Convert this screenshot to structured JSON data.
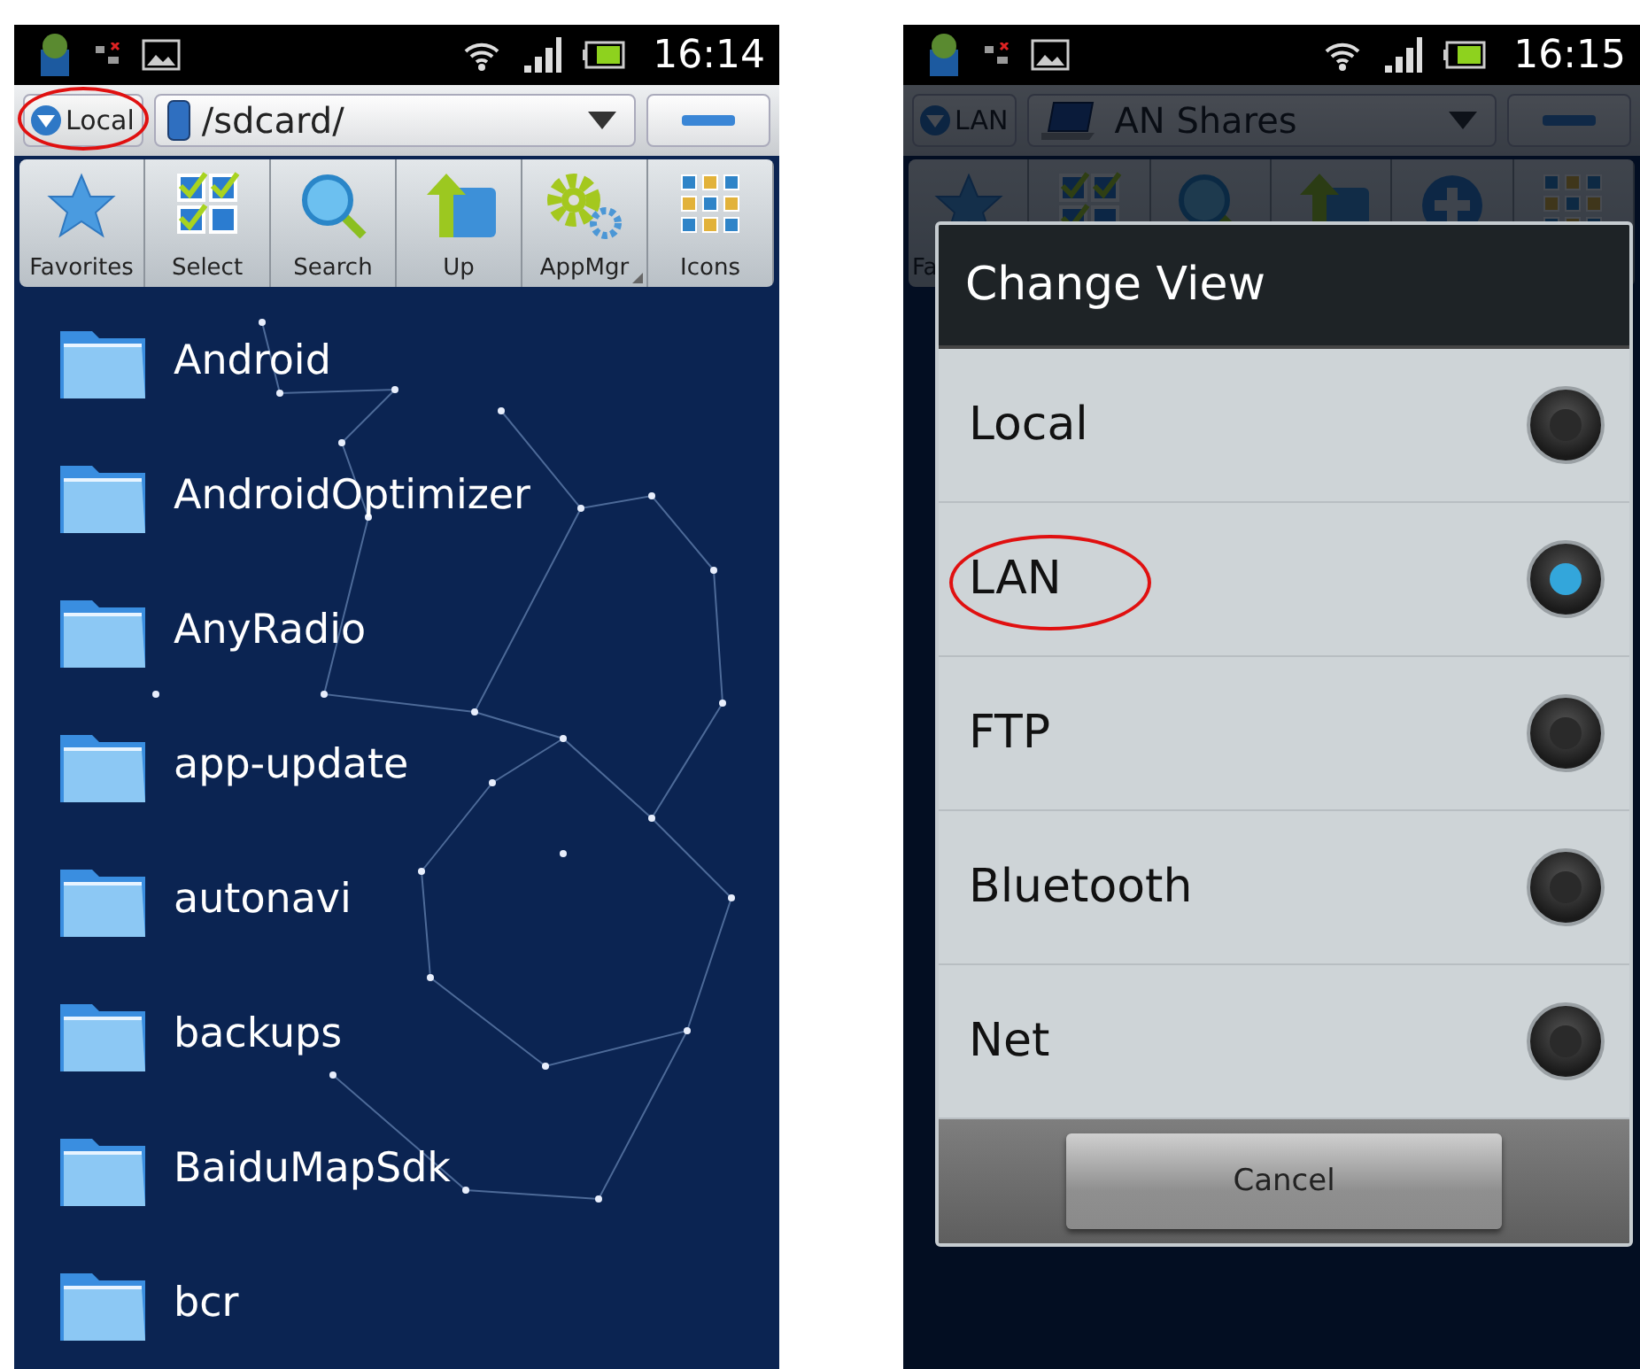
{
  "left_screen": {
    "status_bar": {
      "time": "16:14"
    },
    "location_button": {
      "label": "Local",
      "annotated": true
    },
    "path": {
      "text": "/sdcard/",
      "kind": "phone"
    },
    "toolbar": [
      {
        "label": "Favorites",
        "kind": "star"
      },
      {
        "label": "Select",
        "kind": "checklist"
      },
      {
        "label": "Search",
        "kind": "search"
      },
      {
        "label": "Up",
        "kind": "up"
      },
      {
        "label": "AppMgr",
        "kind": "gear"
      },
      {
        "label": "Icons",
        "kind": "grid"
      }
    ],
    "files": [
      {
        "name": "Android"
      },
      {
        "name": "AndroidOptimizer"
      },
      {
        "name": "AnyRadio"
      },
      {
        "name": "app-update"
      },
      {
        "name": "autonavi"
      },
      {
        "name": "backups"
      },
      {
        "name": "BaiduMapSdk"
      },
      {
        "name": "bcr"
      }
    ]
  },
  "right_screen": {
    "status_bar": {
      "time": "16:15"
    },
    "location_button": {
      "label": "LAN"
    },
    "path": {
      "text": "AN Shares",
      "kind": "laptop"
    },
    "toolbar": [
      {
        "label": "Fa",
        "kind": "star"
      },
      {
        "kind": "checklist"
      },
      {
        "kind": "search"
      },
      {
        "kind": "up"
      },
      {
        "kind": "plus"
      },
      {
        "kind": "grid"
      }
    ],
    "dialog": {
      "title": "Change View",
      "options": [
        {
          "label": "Local",
          "selected": false,
          "annotated": false
        },
        {
          "label": "LAN",
          "selected": true,
          "annotated": true
        },
        {
          "label": "FTP",
          "selected": false,
          "annotated": false
        },
        {
          "label": "Bluetooth",
          "selected": false,
          "annotated": false
        },
        {
          "label": "Net",
          "selected": false,
          "annotated": false
        }
      ],
      "button": "Cancel"
    }
  }
}
